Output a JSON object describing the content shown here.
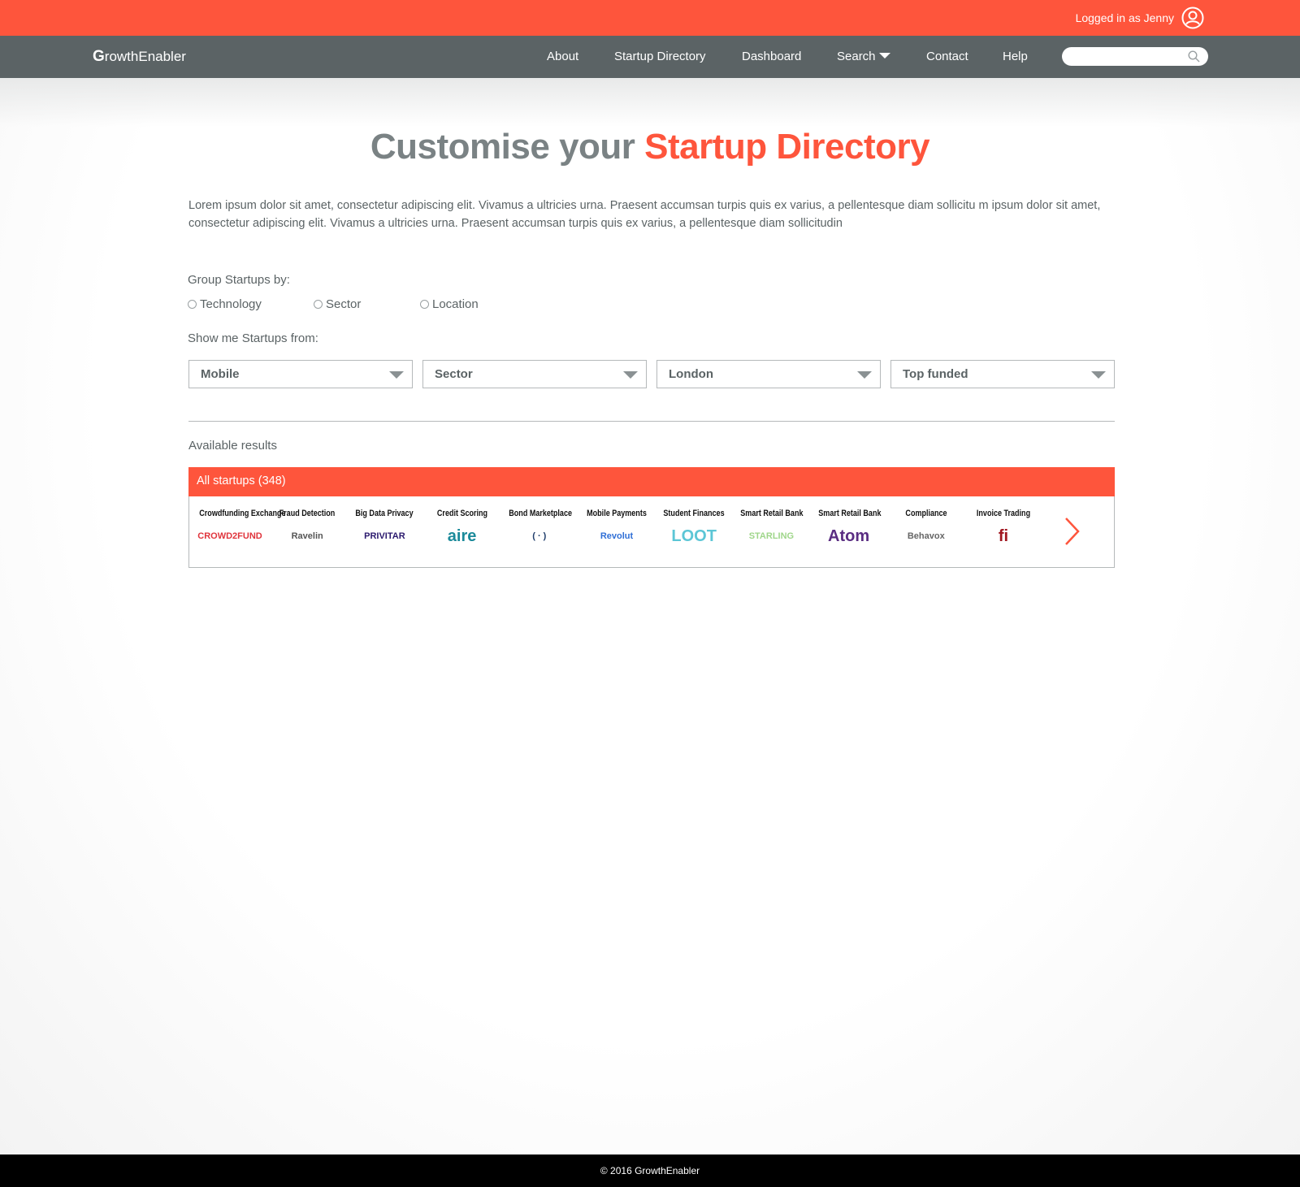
{
  "topbar": {
    "login_text": "Logged in as Jenny",
    "user_icon": "user-circle-icon"
  },
  "navbar": {
    "logo_initial": "G",
    "logo_rest": "rowthEnabler",
    "items": [
      {
        "label": "About"
      },
      {
        "label": "Startup Directory"
      },
      {
        "label": "Dashboard"
      },
      {
        "label": "Search"
      },
      {
        "label": "Contact"
      },
      {
        "label": "Help"
      }
    ],
    "search": {
      "placeholder": "",
      "icon": "search-icon"
    }
  },
  "page": {
    "title_part1": "Customise your",
    "title_part2": "Startup Directory",
    "intro": "Lorem ipsum dolor sit amet, consectetur adipiscing elit. Vivamus a ultricies urna. Praesent accumsan turpis quis ex varius, a pellentesque diam sollicitu m ipsum dolor sit amet, consectetur adipiscing elit. Vivamus a ultricies urna. Praesent accumsan turpis quis ex varius, a pellentesque diam sollicitudin"
  },
  "group_by": {
    "label": "Group Startups by:",
    "options": [
      "Technology",
      "Sector",
      "Location"
    ]
  },
  "filters": {
    "label": "Show me Startups from:",
    "selects": [
      {
        "value": "Mobile"
      },
      {
        "value": "Sector"
      },
      {
        "value": "London"
      },
      {
        "value": "Top funded"
      }
    ]
  },
  "results": {
    "label": "Available results",
    "header": "All startups (348)",
    "cards": [
      {
        "category": "Crowdfunding Exchange",
        "logo": "CROWD2FUND",
        "color": "#e0343c"
      },
      {
        "category": "Fraud Detection",
        "logo": "Ravelin",
        "color": "#555555"
      },
      {
        "category": "Big Data Privacy",
        "logo": "PRIVITAR",
        "color": "#2b1a6e"
      },
      {
        "category": "Credit Scoring",
        "logo": "aire",
        "color": "#1b8a9a"
      },
      {
        "category": "Bond Marketplace",
        "logo": "( · )",
        "color": "#1f3d6b"
      },
      {
        "category": "Mobile Payments",
        "logo": "Revolut",
        "color": "#2f6fd6"
      },
      {
        "category": "Student Finances",
        "logo": "LOOT",
        "color": "#5cc6d6"
      },
      {
        "category": "Smart Retail Bank",
        "logo": "STARLING",
        "color": "#9fd68a"
      },
      {
        "category": "Smart Retail Bank",
        "logo": "Atom",
        "color": "#5a2d82"
      },
      {
        "category": "Compliance",
        "logo": "Behavox",
        "color": "#666666"
      },
      {
        "category": "Invoice Trading",
        "logo": "fi",
        "color": "#a0151e"
      }
    ]
  },
  "footer": {
    "text": "© 2016 GrowthEnabler"
  }
}
